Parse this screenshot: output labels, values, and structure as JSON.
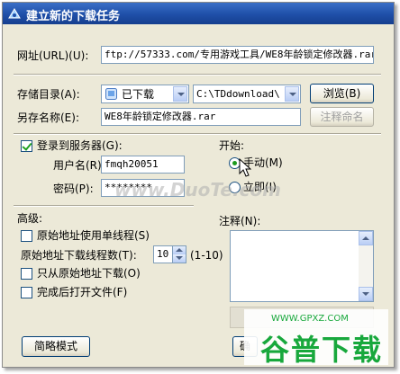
{
  "window": {
    "title": "建立新的下载任务"
  },
  "url": {
    "label": "网址(URL)(U):",
    "value": "ftp://57333.com/专用游戏工具/WE8年龄锁定修改器.rar"
  },
  "storage": {
    "dir_label": "存储目录(A):",
    "category_value": "已下载",
    "path_value": "C:\\TDdownload\\",
    "browse_label": "浏览(B)",
    "saveas_label": "另存名称(E):",
    "saveas_value": "WE8年龄锁定修改器.rar",
    "rename_label": "注释命名"
  },
  "server": {
    "login_label": "登录到服务器(G):",
    "login_checked": true,
    "username_label": "用户名(R):",
    "username_value": "fmqh20051",
    "password_label": "密码(P):",
    "password_value": "********"
  },
  "start": {
    "label": "开始:",
    "manual_label": "手动(M)",
    "manual_selected": true,
    "immediate_label": "立即(I)",
    "immediate_selected": false
  },
  "advanced": {
    "label": "高级:",
    "single_thread_label": "原始地址使用单线程(S)",
    "threads_label": "原始地址下载线程数(T):",
    "threads_value": "10",
    "threads_range": "(1-10)",
    "only_original_label": "只从原始地址下载(O)",
    "open_after_label": "完成后打开文件(F)"
  },
  "comment": {
    "label": "注释(N):"
  },
  "buttons": {
    "simple_mode": "简略模式",
    "ok_partial": "确"
  },
  "watermarks": {
    "duote": "www.DuoTe.com",
    "gpxz_url": "WWW.GPXZ.COM",
    "gpxz_name": "谷普下载"
  },
  "colors": {
    "titlebar": "#1f4fa8",
    "dialog_bg": "#ece9d8",
    "watermark_green": "#18a83c"
  }
}
